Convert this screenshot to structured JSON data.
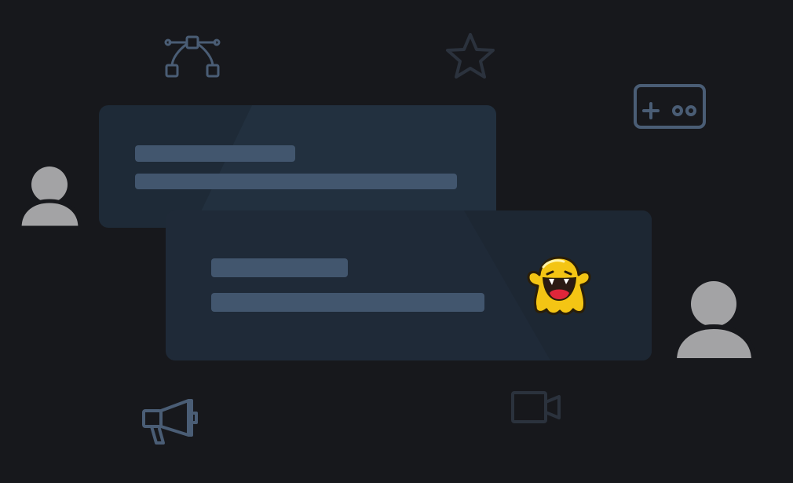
{
  "background": "#17181c",
  "icons": {
    "bezier": "bezier-curve-icon",
    "star": "star-icon",
    "gamepad": "gamepad-icon",
    "user_left": "user-icon",
    "user_right": "user-icon",
    "megaphone": "megaphone-icon",
    "video": "video-camera-icon",
    "emoji": "laughing-ghost-emoji"
  },
  "colors": {
    "card_back": "#1e2a37",
    "card_front": "#1f2a38",
    "placeholder_line": "#42566e",
    "icon_outline": "#4a5d75",
    "user_silhouette": "#a3a3a5",
    "emoji_yellow": "#f4c514"
  }
}
